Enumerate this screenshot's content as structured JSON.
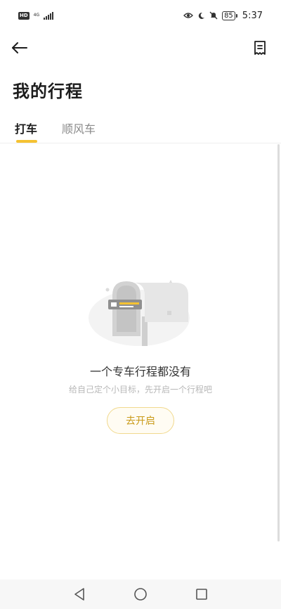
{
  "status_bar": {
    "hd": "HD",
    "network": "4G",
    "battery": "85",
    "time": "5:37"
  },
  "header": {
    "back_icon": "arrow-left-icon",
    "receipt_icon": "receipt-icon"
  },
  "page": {
    "title": "我的行程"
  },
  "tabs": [
    {
      "label": "打车",
      "active": true
    },
    {
      "label": "顺风车",
      "active": false
    }
  ],
  "empty_state": {
    "title": "一个专车行程都没有",
    "subtitle": "给自己定个小目标，先开启一个行程吧",
    "button_label": "去开启",
    "illustration": "mailbox-icon"
  },
  "nav_bar": {
    "back": "triangle-back-icon",
    "home": "circle-home-icon",
    "recents": "square-recents-icon"
  },
  "colors": {
    "accent": "#f5c232",
    "button_text": "#c99a18",
    "button_border": "#f1d98e"
  }
}
